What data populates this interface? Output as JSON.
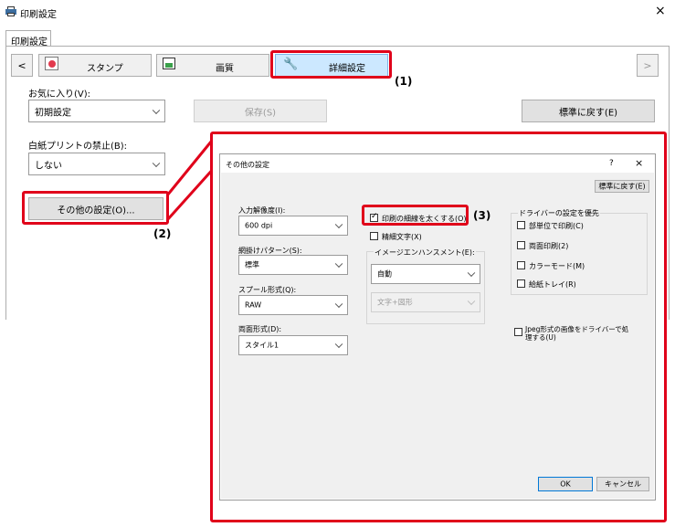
{
  "window": {
    "title": "印刷設定",
    "close": "×"
  },
  "tabbar": {
    "tab": "印刷設定"
  },
  "toolbar": {
    "prev": "<",
    "next": ">",
    "tabs": [
      {
        "label": "スタンプ"
      },
      {
        "label": "画質"
      },
      {
        "label": "詳細設定"
      }
    ]
  },
  "favorites": {
    "label": "お気に入り(V):",
    "value": "初期設定",
    "save": "保存(S)",
    "reset": "標準に戻す(E)"
  },
  "blank": {
    "label": "白紙プリントの禁止(B):",
    "value": "しない"
  },
  "other_button": {
    "label": "その他の設定(O)..."
  },
  "callouts": {
    "c1": "(1)",
    "c2": "(2)",
    "c3": "(3)"
  },
  "dialog": {
    "title": "その他の設定",
    "help": "?",
    "close": "×",
    "reset": "標準に戻す(E)",
    "resolution": {
      "label": "入力解像度(I):",
      "value": "600 dpi"
    },
    "pattern": {
      "label": "網掛けパターン(S):",
      "value": "標準"
    },
    "spool": {
      "label": "スプール形式(Q):",
      "value": "RAW"
    },
    "duplex": {
      "label": "両面形式(D):",
      "value": "スタイル1"
    },
    "thin_lines": {
      "label": "印刷の細線を太くする(O)",
      "checked": true
    },
    "fine_text": {
      "label": "精細文字(X)",
      "checked": false
    },
    "image_enhance": {
      "label": "イメージエンハンスメント(E):",
      "value": "自動",
      "sub": "文字+図形"
    },
    "driver_group": {
      "label": "ドライバーの設定を優先",
      "items": [
        {
          "label": "部単位で印刷(C)",
          "checked": false
        },
        {
          "label": "両面印刷(2)",
          "checked": false
        },
        {
          "label": "カラーモード(M)",
          "checked": false
        },
        {
          "label": "給紙トレイ(R)",
          "checked": false
        }
      ]
    },
    "jpeg": {
      "label1": "Jpeg形式の画像をドライバーで処",
      "label2": "理する(U)",
      "checked": false
    },
    "ok": "OK",
    "cancel": "キャンセル"
  },
  "colors": {
    "highlight": "#e0001a",
    "tab_active": "#cce8ff"
  }
}
